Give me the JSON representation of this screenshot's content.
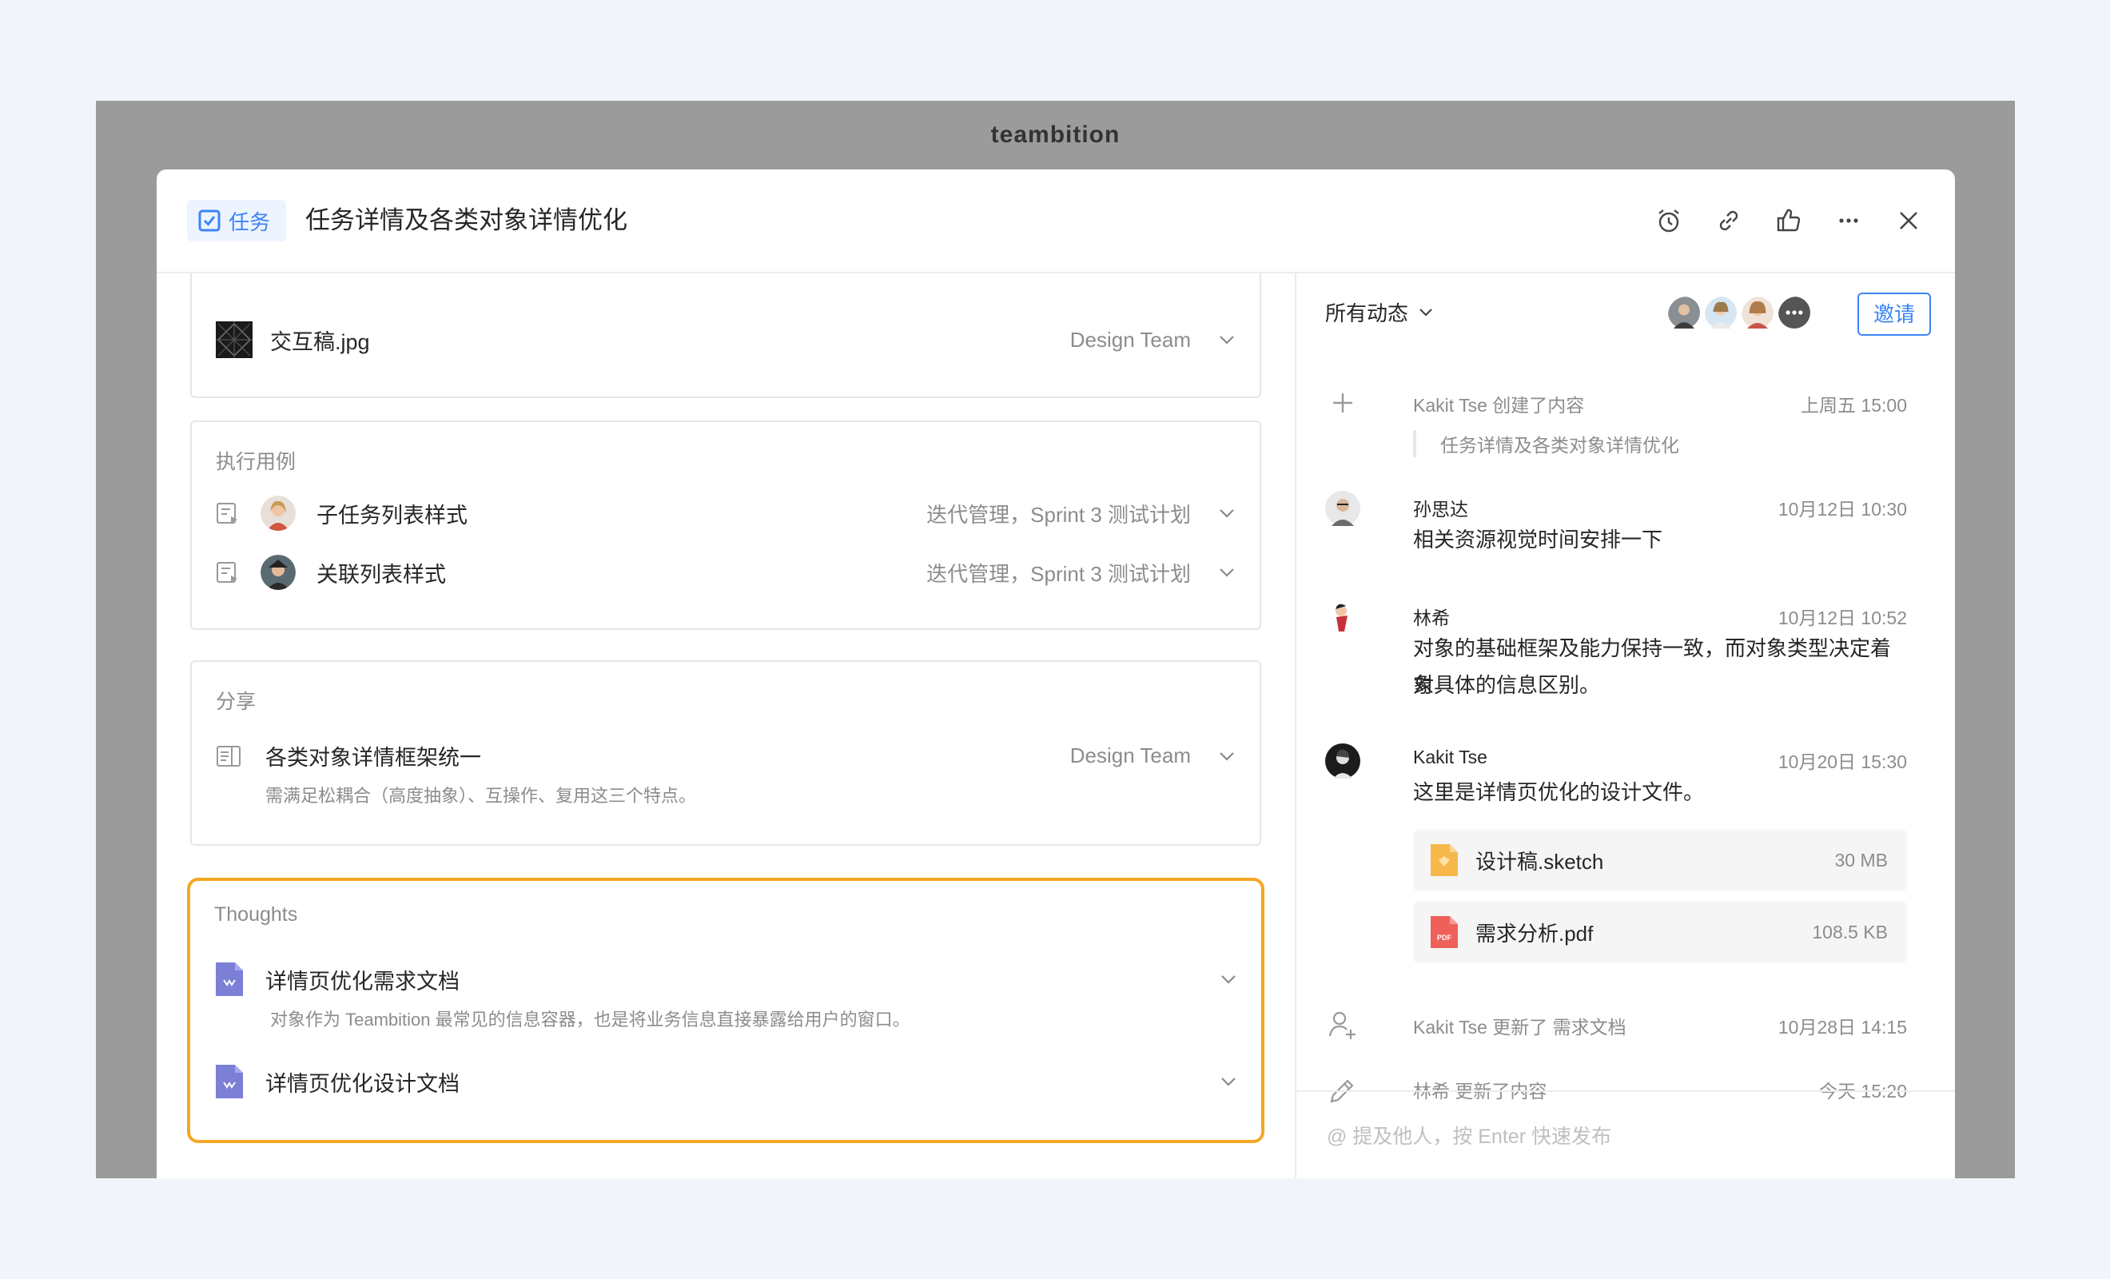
{
  "app": {
    "title": "teambition"
  },
  "header": {
    "type_label": "任务",
    "task_title": "任务详情及各类对象详情优化",
    "icons": [
      "alarm-icon",
      "link-icon",
      "thumbs-up-icon",
      "more-icon",
      "close-icon"
    ]
  },
  "attachment": {
    "name": "交互稿.jpg",
    "team": "Design Team"
  },
  "test_cases": {
    "label": "执行用例",
    "items": [
      {
        "name": "子任务列表样式",
        "meta": "迭代管理，Sprint 3 测试计划"
      },
      {
        "name": "关联列表样式",
        "meta": "迭代管理，Sprint 3 测试计划"
      }
    ]
  },
  "share": {
    "label": "分享",
    "items": [
      {
        "name": "各类对象详情框架统一",
        "desc": "需满足松耦合（高度抽象）、互操作、复用这三个特点。",
        "team": "Design Team"
      }
    ]
  },
  "thoughts": {
    "label": "Thoughts",
    "items": [
      {
        "name": "详情页优化需求文档",
        "desc": "对象作为 Teambition 最常见的信息容器，也是将业务信息直接暴露给用户的窗口。"
      },
      {
        "name": "详情页优化设计文档"
      }
    ]
  },
  "activity": {
    "filter_label": "所有动态",
    "invite_label": "邀请",
    "items": [
      {
        "who": "Kakit Tse 创建了内容",
        "time": "上周五 15:00",
        "quote": "任务详情及各类对象详情优化"
      },
      {
        "who": "孙思达",
        "time": "10月12日 10:30",
        "text": "相关资源视觉时间安排一下"
      },
      {
        "who": "林希",
        "time": "10月12日 10:52",
        "text_line1": "对象的基础框架及能力保持一致，而对象类型决定着对",
        "text_line2": "象具体的信息区别。"
      },
      {
        "who": "Kakit Tse",
        "time": "10月20日 15:30",
        "text": "这里是详情页优化的设计文件。",
        "files": [
          {
            "name": "设计稿.sketch",
            "size": "30 MB"
          },
          {
            "name": "需求分析.pdf",
            "size": "108.5 KB"
          }
        ]
      },
      {
        "who": "Kakit Tse 更新了 需求文档",
        "time": "10月28日 14:15"
      },
      {
        "who": "林希 更新了内容",
        "time": "今天 15:20"
      }
    ],
    "composer_placeholder": "@ 提及他人，按 Enter 快速发布"
  },
  "colors": {
    "accent": "#3d84f7",
    "highlight": "#f5a623",
    "doc_icon": "#7b7fd6"
  }
}
